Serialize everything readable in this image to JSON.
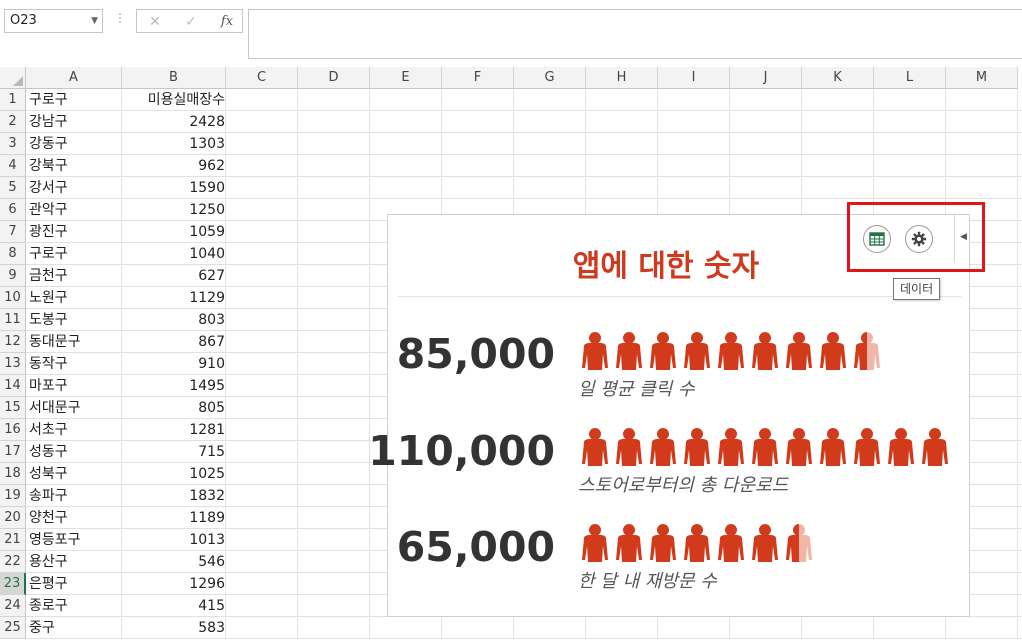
{
  "formula_bar": {
    "name_box": "O23",
    "cancel_icon": "✕",
    "enter_icon": "✓",
    "fx_label": "fx",
    "formula": ""
  },
  "columns": [
    "A",
    "B",
    "C",
    "D",
    "E",
    "F",
    "G",
    "H",
    "I",
    "J",
    "K",
    "L",
    "M"
  ],
  "rows": [
    {
      "num": "1",
      "a": "구로구",
      "b": "미용실매장수"
    },
    {
      "num": "2",
      "a": "강남구",
      "b": "2428"
    },
    {
      "num": "3",
      "a": "강동구",
      "b": "1303"
    },
    {
      "num": "4",
      "a": "강북구",
      "b": "962"
    },
    {
      "num": "5",
      "a": "강서구",
      "b": "1590"
    },
    {
      "num": "6",
      "a": "관악구",
      "b": "1250"
    },
    {
      "num": "7",
      "a": "광진구",
      "b": "1059"
    },
    {
      "num": "8",
      "a": "구로구",
      "b": "1040"
    },
    {
      "num": "9",
      "a": "금천구",
      "b": "627"
    },
    {
      "num": "10",
      "a": "노원구",
      "b": "1129"
    },
    {
      "num": "11",
      "a": "도봉구",
      "b": "803"
    },
    {
      "num": "12",
      "a": "동대문구",
      "b": "867"
    },
    {
      "num": "13",
      "a": "동작구",
      "b": "910"
    },
    {
      "num": "14",
      "a": "마포구",
      "b": "1495"
    },
    {
      "num": "15",
      "a": "서대문구",
      "b": "805"
    },
    {
      "num": "16",
      "a": "서초구",
      "b": "1281"
    },
    {
      "num": "17",
      "a": "성동구",
      "b": "715"
    },
    {
      "num": "18",
      "a": "성북구",
      "b": "1025"
    },
    {
      "num": "19",
      "a": "송파구",
      "b": "1832"
    },
    {
      "num": "20",
      "a": "양천구",
      "b": "1189"
    },
    {
      "num": "21",
      "a": "영등포구",
      "b": "1013"
    },
    {
      "num": "22",
      "a": "용산구",
      "b": "546"
    },
    {
      "num": "23",
      "a": "은평구",
      "b": "1296"
    },
    {
      "num": "24",
      "a": "종로구",
      "b": "415"
    },
    {
      "num": "25",
      "a": "중구",
      "b": "583"
    }
  ],
  "selected_row": "23",
  "panel": {
    "title": "앱에 대한 숫자",
    "accent_color": "#d23a1c",
    "faded_color": "#f0b7a8",
    "table_icon": "table-icon",
    "settings_icon": "gear-icon",
    "tooltip": "데이터",
    "stats": [
      {
        "value": "85,000",
        "label": "일 평균 클릭 수",
        "people": 8.5
      },
      {
        "value": "110,000",
        "label": "스토어로부터의 총 다운로드",
        "people": 11
      },
      {
        "value": "65,000",
        "label": "한 달 내 재방문 수",
        "people": 6.5
      }
    ]
  }
}
